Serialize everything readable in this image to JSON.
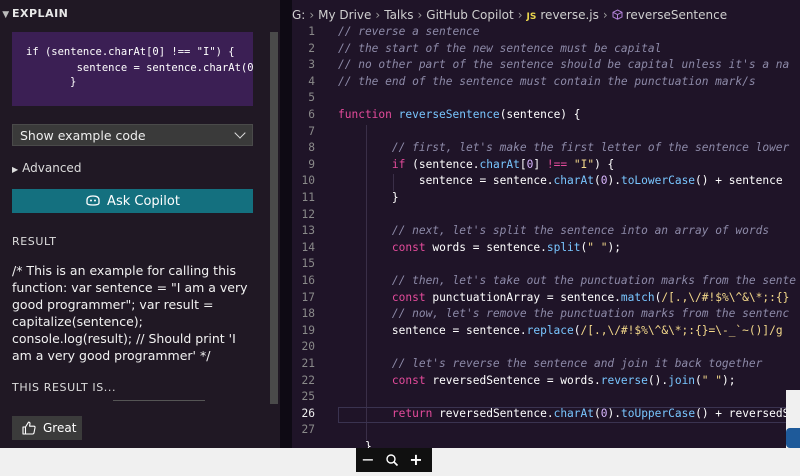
{
  "sidebar": {
    "section_title": "EXPLAIN",
    "example_code_lines": [
      "if (sentence.charAt[0] !== \"I\") {",
      "        sentence = sentence.charAt(0",
      "}"
    ],
    "dropdown_value": "Show example code",
    "advanced_label": "Advanced",
    "ask_button_label": "Ask Copilot",
    "result_heading": "RESULT",
    "result_text": "/* This is an example for calling this function: var sentence = \"I am a very good programmer\"; var result = capitalize(sentence); console.log(result); // Should print 'I am a very good programmer' */",
    "rating_heading": "THIS RESULT IS...",
    "great_button_label": "Great"
  },
  "breadcrumb": {
    "items": [
      "G:",
      "My Drive",
      "Talks",
      "GitHub Copilot"
    ],
    "file_badge": "JS",
    "file_name": "reverse.js",
    "symbol": "reverseSentence"
  },
  "editor": {
    "active_line": 26,
    "lines": [
      {
        "n": "1",
        "html": "<span class='c-com'>// reverse a sentence</span>"
      },
      {
        "n": "2",
        "html": "<span class='c-com'>// the start of the new sentence must be capital</span>"
      },
      {
        "n": "3",
        "html": "<span class='c-com'>// no other part of the sentence should be capital unless it's a na</span>"
      },
      {
        "n": "4",
        "html": "<span class='c-com'>// the end of the sentence must contain the punctuation mark/s</span>"
      },
      {
        "n": "5",
        "html": ""
      },
      {
        "n": "6",
        "html": "<span class='c-kw'>function</span> <span class='c-fn'>reverseSentence</span><span class='c-txt'>(sentence) {</span>"
      },
      {
        "n": "7",
        "html": ""
      },
      {
        "n": "8",
        "html": "        <span class='c-com'>// first, let's make the first letter of the sentence lower</span>"
      },
      {
        "n": "9",
        "html": "        <span class='c-kw'>if</span> <span class='c-txt'>(sentence.</span><span class='c-mth'>charAt</span><span class='c-txt'>[</span><span class='c-num'>0</span><span class='c-txt'>] </span><span class='c-kw'>!==</span> <span class='c-str'>\"I\"</span><span class='c-txt'>) {</span>"
      },
      {
        "n": "10",
        "html": "            <span class='c-txt'>sentence = sentence.</span><span class='c-mth'>charAt</span><span class='c-txt'>(</span><span class='c-num'>0</span><span class='c-txt'>).</span><span class='c-mth'>toLowerCase</span><span class='c-txt'>() + sentence</span>"
      },
      {
        "n": "11",
        "html": "        <span class='c-txt'>}</span>"
      },
      {
        "n": "12",
        "html": ""
      },
      {
        "n": "13",
        "html": "        <span class='c-com'>// next, let's split the sentence into an array of words</span>"
      },
      {
        "n": "14",
        "html": "        <span class='c-kw'>const</span> <span class='c-txt'>words = sentence.</span><span class='c-mth'>split</span><span class='c-txt'>(</span><span class='c-str'>\" \"</span><span class='c-txt'>);</span>"
      },
      {
        "n": "15",
        "html": ""
      },
      {
        "n": "16",
        "html": "        <span class='c-com'>// then, let's take out the punctuation marks from the sente</span>"
      },
      {
        "n": "17",
        "html": "        <span class='c-kw'>const</span> <span class='c-txt'>punctuationArray = sentence.</span><span class='c-mth'>match</span><span class='c-txt'>(</span><span class='c-rx'>/[.,\\/#!$%\\^&amp;\\*;:{}</span>"
      },
      {
        "n": "18",
        "html": "        <span class='c-com'>// now, let's remove the punctuation marks from the sentenc</span>"
      },
      {
        "n": "19",
        "html": "        <span class='c-txt'>sentence = sentence.</span><span class='c-mth'>replace</span><span class='c-txt'>(</span><span class='c-rx'>/[.,\\/#!$%\\^&amp;\\*;:{}=\\-_`~()]/g</span>"
      },
      {
        "n": "20",
        "html": ""
      },
      {
        "n": "21",
        "html": "        <span class='c-com'>// let's reverse the sentence and join it back together</span>"
      },
      {
        "n": "22",
        "html": "        <span class='c-kw'>const</span> <span class='c-txt'>reversedSentence = words.</span><span class='c-mth'>reverse</span><span class='c-txt'>().</span><span class='c-mth'>join</span><span class='c-txt'>(</span><span class='c-str'>\" \"</span><span class='c-txt'>);</span>"
      },
      {
        "n": "25",
        "html": ""
      },
      {
        "n": "26",
        "html": "        <span class='c-kw'>return</span> <span class='c-txt'>reversedSentence.</span><span class='c-mth'>charAt</span><span class='c-txt'>(</span><span class='c-num'>0</span><span class='c-txt'>).</span><span class='c-mth'>toUpperCase</span><span class='c-txt'>() + reversedS</span>"
      },
      {
        "n": "27",
        "html": ""
      },
      {
        "n": "",
        "html": "    <span class='c-txt'>}</span>"
      }
    ]
  },
  "zoom": {
    "minus": "−",
    "plus": "+"
  },
  "colors": {
    "accent": "#14707f",
    "editor_bg": "#1f1428",
    "code_box": "#3b1f54"
  }
}
